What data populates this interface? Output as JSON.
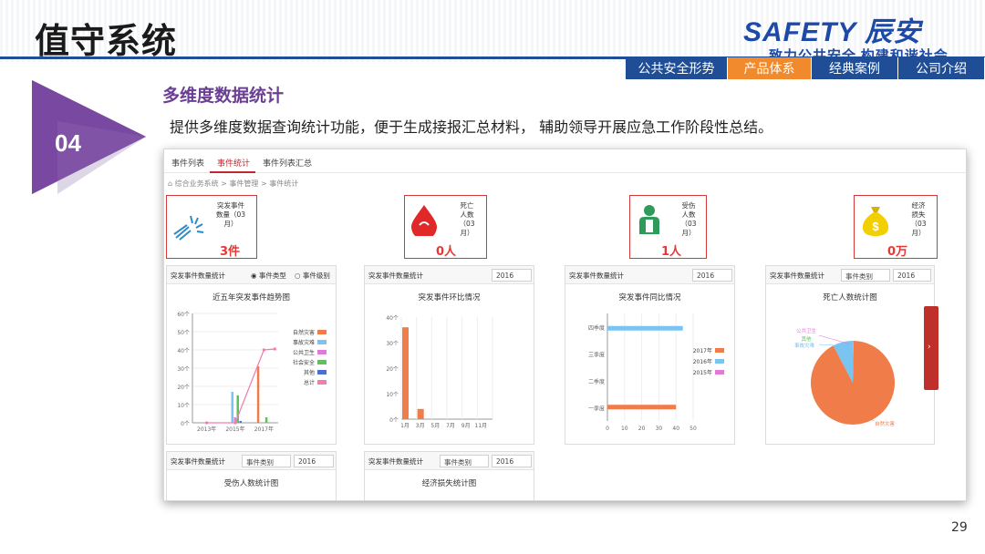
{
  "slide": {
    "title": "值守系统",
    "logo_main": "SAFETY 辰安",
    "logo_sub": "致力公共安全 构建和谐社会",
    "nav": [
      "公共安全形势",
      "产品体系",
      "经典案例",
      "公司介绍"
    ],
    "nav_active": 1,
    "badge_number": "04",
    "section_title": "多维度数据统计",
    "description": "提供多维度数据查询统计功能，便于生成接报汇总材料，  辅助领导开展应急工作阶段性总结。",
    "page_number": "29"
  },
  "app": {
    "tabs": [
      "事件列表",
      "事件统计",
      "事件列表汇总"
    ],
    "active_tab": 1,
    "breadcrumb": "⌂ 综合业务系统 > 事件管理 > 事件统计",
    "stats": [
      {
        "label": "突发事件\n数量（03\n月）",
        "value": "3件",
        "icon": "alarm-icon"
      },
      {
        "label": "死亡\n人数\n（03\n月）",
        "value": "0人",
        "icon": "blood-drop-icon"
      },
      {
        "label": "受伤\n人数\n（03\n月）",
        "value": "1人",
        "icon": "injured-person-icon"
      },
      {
        "label": "经济\n损失\n（03\n月）",
        "value": "0万",
        "icon": "money-bag-icon"
      }
    ],
    "panels": [
      {
        "head": "突发事件数量统计",
        "radio1": "◉ 事件类型",
        "radio2": "○ 事件级别",
        "title": "近五年突发事件趋势图"
      },
      {
        "head": "突发事件数量统计",
        "select": "2016",
        "title": "突发事件环比情况"
      },
      {
        "head": "突发事件数量统计",
        "select": "2016",
        "title": "突发事件同比情况"
      },
      {
        "head": "突发事件数量统计",
        "select1": "事件类别",
        "select2": "2016",
        "title": "死亡人数统计图"
      },
      {
        "head": "突发事件数量统计",
        "select1": "事件类别",
        "select2": "2016",
        "title": "受伤人数统计图"
      },
      {
        "head": "突发事件数量统计",
        "select1": "事件类别",
        "select2": "2016",
        "title": "经济损失统计图"
      }
    ]
  },
  "chart_data": [
    {
      "type": "bar",
      "title": "近五年突发事件趋势图",
      "categories": [
        "2013年",
        "2015年",
        "2017年"
      ],
      "ylim": [
        0,
        60
      ],
      "yticks": [
        "0个",
        "10个",
        "20个",
        "30个",
        "40个",
        "50个",
        "60个"
      ],
      "legend": [
        "自然灾害",
        "事故灾难",
        "公共卫生",
        "社会安全",
        "其他",
        "总计"
      ],
      "colors": [
        "#f07c4a",
        "#79c4f0",
        "#e07ad8",
        "#5cc25c",
        "#4a6fd0",
        "#f07cb0"
      ],
      "series": [
        {
          "name": "自然灾害",
          "values": [
            0,
            0,
            31
          ]
        },
        {
          "name": "事故灾难",
          "values": [
            0,
            17,
            0
          ]
        },
        {
          "name": "公共卫生",
          "values": [
            0,
            3,
            0
          ]
        },
        {
          "name": "社会安全",
          "values": [
            0,
            15,
            3
          ]
        },
        {
          "name": "其他",
          "values": [
            0,
            1,
            0
          ]
        },
        {
          "name": "总计",
          "values": [
            0,
            0,
            40
          ]
        }
      ]
    },
    {
      "type": "bar",
      "title": "突发事件环比情况",
      "categories": [
        "1月",
        "3月",
        "5月",
        "7月",
        "9月",
        "11月"
      ],
      "ylim": [
        0,
        40
      ],
      "yticks": [
        "0个",
        "10个",
        "20个",
        "30个",
        "40个"
      ],
      "values": [
        36,
        4,
        0,
        0,
        0,
        0
      ],
      "color": "#f07c4a"
    },
    {
      "type": "bar",
      "title": "突发事件同比情况",
      "orientation": "horizontal",
      "categories": [
        "一季度",
        "二季度",
        "三季度",
        "四季度"
      ],
      "xlim": [
        0,
        50
      ],
      "xticks": [
        "0",
        "10",
        "20",
        "30",
        "40",
        "50"
      ],
      "legend": [
        "2017年",
        "2016年",
        "2015年"
      ],
      "colors": [
        "#f07c4a",
        "#79c4f0",
        "#e07ad8"
      ],
      "series": [
        {
          "name": "2017年",
          "values": [
            40,
            0,
            0,
            0
          ]
        },
        {
          "name": "2016年",
          "values": [
            0,
            0,
            0,
            44
          ]
        },
        {
          "name": "2015年",
          "values": [
            0,
            0,
            0,
            0
          ]
        }
      ]
    },
    {
      "type": "pie",
      "title": "死亡人数统计图",
      "labels": [
        "自然灾害",
        "事故灾难",
        "公共卫生",
        "其他"
      ],
      "values": [
        92,
        8,
        0,
        0
      ],
      "colors": [
        "#f07c4a",
        "#79c4f0",
        "#e07ad8",
        "#5cc25c"
      ]
    }
  ]
}
